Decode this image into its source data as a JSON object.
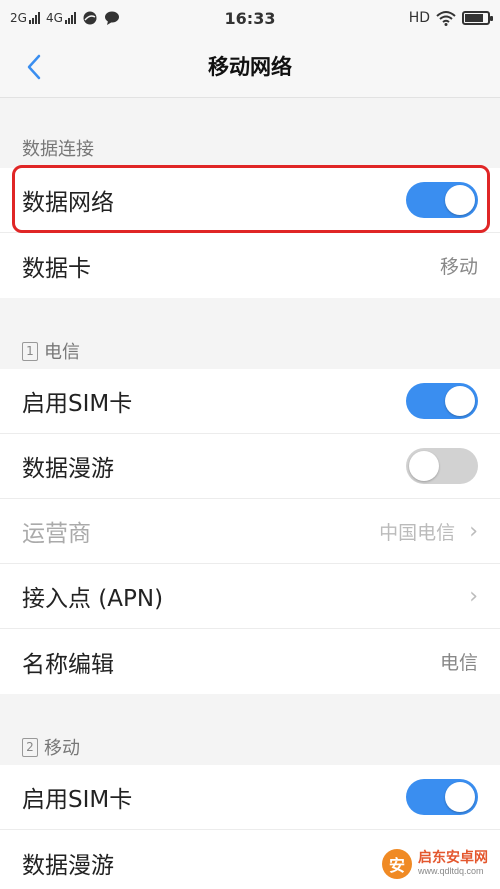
{
  "status_bar": {
    "net1": "2G",
    "net2": "4G",
    "time": "16:33",
    "hd": "HD"
  },
  "header": {
    "title": "移动网络",
    "back_icon": "chevron-left-icon"
  },
  "data_connection": {
    "header": "数据连接",
    "data_network_label": "数据网络",
    "data_network_on": true,
    "data_card_label": "数据卡",
    "data_card_value": "移动"
  },
  "sim1": {
    "badge": "1",
    "header": "电信",
    "enable_label": "启用SIM卡",
    "enable_on": true,
    "roaming_label": "数据漫游",
    "roaming_on": false,
    "carrier_label": "运营商",
    "carrier_value": "中国电信",
    "apn_label": "接入点 (APN)",
    "name_edit_label": "名称编辑",
    "name_edit_value": "电信"
  },
  "sim2": {
    "badge": "2",
    "header": "移动",
    "enable_label": "启用SIM卡",
    "enable_on": true,
    "roaming_label": "数据漫游"
  },
  "watermark": {
    "name": "启东安卓网",
    "url": "www.qdltdq.com"
  },
  "colors": {
    "accent": "#3a8ef0",
    "highlight": "#e02626"
  }
}
